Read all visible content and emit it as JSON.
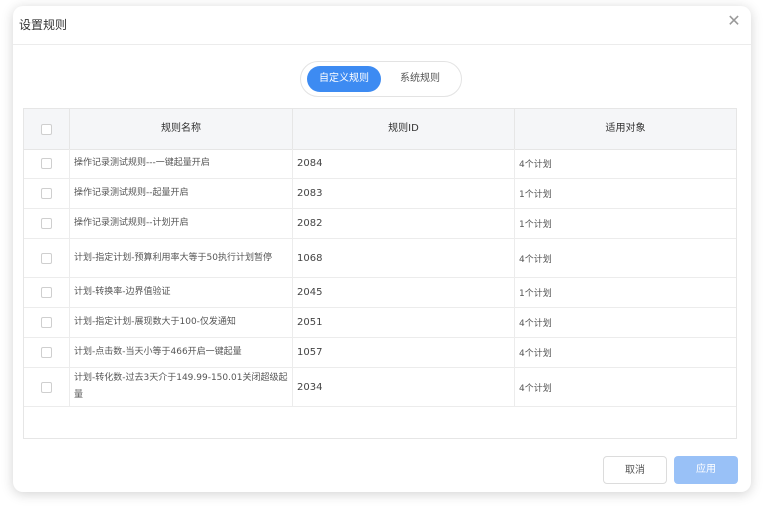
{
  "dialog": {
    "title": "设置规则",
    "close_glyph": "✕"
  },
  "segments": {
    "custom_label": "自定义规则",
    "system_label": "系统规则",
    "active": "custom"
  },
  "table": {
    "headers": [
      "规则名称",
      "规则ID",
      "适用对象"
    ],
    "rows": [
      {
        "name": "操作记录测试规则---一键起量开启",
        "id": "2084",
        "target": "4个计划"
      },
      {
        "name": "操作记录测试规则--起量开启",
        "id": "2083",
        "target": "1个计划"
      },
      {
        "name": "操作记录测试规则--计划开启",
        "id": "2082",
        "target": "1个计划"
      },
      {
        "name": "计划-指定计划-预算利用率大等于50执行计划暂停",
        "id": "1068",
        "target": "4个计划"
      },
      {
        "name": "计划-转换率-边界值验证",
        "id": "2045",
        "target": "1个计划"
      },
      {
        "name": "计划-指定计划-展现数大于100-仅发通知",
        "id": "2051",
        "target": "4个计划"
      },
      {
        "name": "计划-点击数-当天小等于466开启一键起量",
        "id": "1057",
        "target": "4个计划"
      },
      {
        "name": "计划-转化数-过去3天介于149.99-150.01关闭超级起量",
        "id": "2034",
        "target": "4个计划"
      }
    ]
  },
  "footer": {
    "cancel_label": "取消",
    "apply_label": "应用"
  },
  "colors": {
    "accent": "#3d8bf2",
    "apply_disabled": "#99c1f7"
  }
}
